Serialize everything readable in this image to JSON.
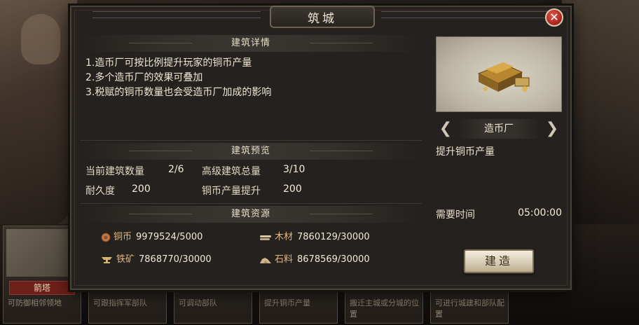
{
  "dialog": {
    "title": "筑城",
    "close_label": "✕"
  },
  "details": {
    "heading": "建筑详情",
    "lines": [
      "1.造币厂可按比例提升玩家的铜币产量",
      "2.多个造币厂的效果可叠加",
      "3.税赋的铜币数量也会受造币厂加成的影响"
    ]
  },
  "preview": {
    "heading": "建筑预览",
    "current_count_label": "当前建筑数量",
    "current_count_value": "2/6",
    "advanced_total_label": "高级建筑总量",
    "advanced_total_value": "3/10",
    "durability_label": "耐久度",
    "durability_value": "200",
    "copper_boost_label": "铜币产量提升",
    "copper_boost_value": "200"
  },
  "resources": {
    "heading": "建筑资源",
    "items": [
      {
        "name": "铜币",
        "value": "9979524/5000",
        "icon": "coin-icon",
        "color": "#c07a4a"
      },
      {
        "name": "木材",
        "value": "7860129/30000",
        "icon": "wood-icon",
        "color": "#d9c6a5"
      },
      {
        "name": "铁矿",
        "value": "7868770/30000",
        "icon": "anvil-icon",
        "color": "#d6b36a"
      },
      {
        "name": "石料",
        "value": "8678569/30000",
        "icon": "stone-icon",
        "color": "#cdb58a"
      }
    ]
  },
  "building": {
    "name": "造币厂",
    "effect": "提升铜币产量",
    "time_label": "需要时间",
    "time_value": "05:00:00",
    "build_label": "建造"
  },
  "background_cards": [
    {
      "title": "箭塔",
      "desc": "可防御相邻领地"
    },
    {
      "title": "",
      "desc": "可跟指挥军部队"
    },
    {
      "title": "",
      "desc": "可调动部队"
    },
    {
      "title": "",
      "desc": "提升铜币产量"
    },
    {
      "title": "",
      "desc": "搬迁主城或分城的位置"
    },
    {
      "title": "",
      "desc": "可进行城建和部队配置"
    }
  ]
}
